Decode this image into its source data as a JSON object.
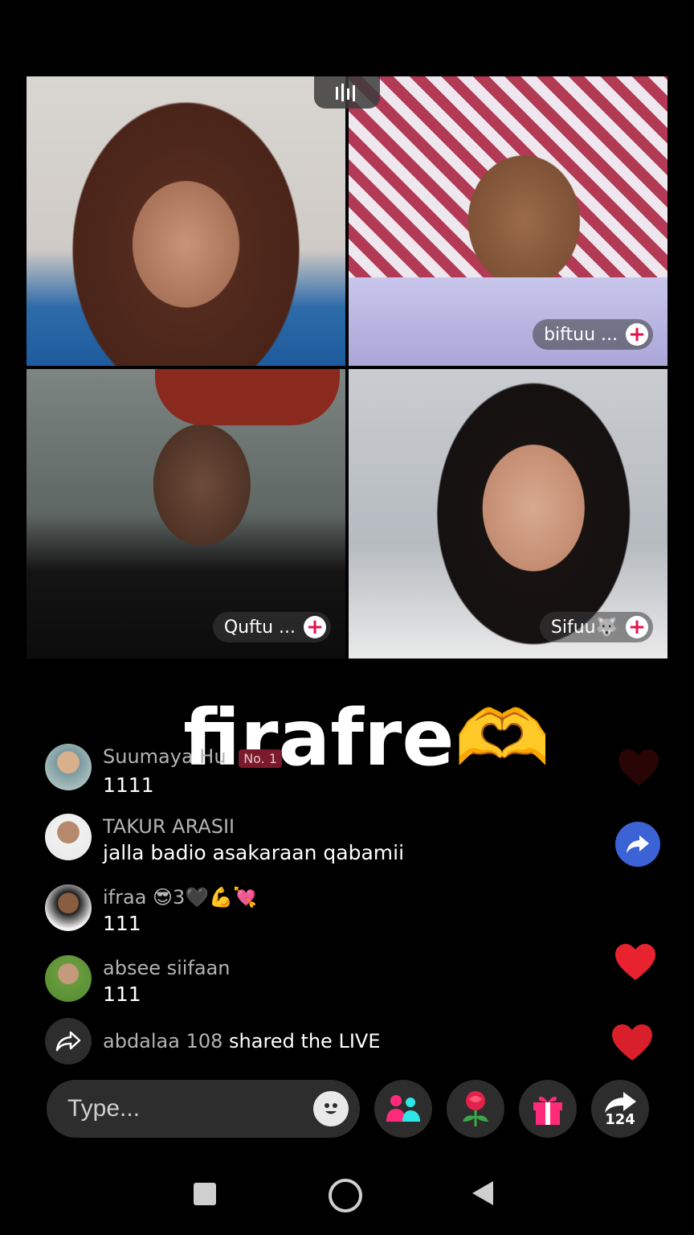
{
  "participants": [
    {
      "name": ""
    },
    {
      "name": "biftuu ..."
    },
    {
      "name": "Quftu ..."
    },
    {
      "name": "Sifuu🐺"
    }
  ],
  "overlay_text": "firafre🫶",
  "comments": [
    {
      "user": "Suumaya Hu",
      "badge": "No. 1",
      "text": "1111"
    },
    {
      "user": "TAKUR ARASII",
      "text": "jalla badio asakaraan qabamii"
    },
    {
      "user": "ifraa 😎3🖤💪💘",
      "text": "111"
    },
    {
      "user": "absee siifaan",
      "text": "111"
    }
  ],
  "share_notice": {
    "user": "abdalaa 108",
    "action": "shared the LIVE"
  },
  "input": {
    "placeholder": "Type..."
  },
  "share_count": "124",
  "colors": {
    "accent": "#e4144e",
    "heart": "#e8222e",
    "share_blue": "#3b63d6"
  }
}
